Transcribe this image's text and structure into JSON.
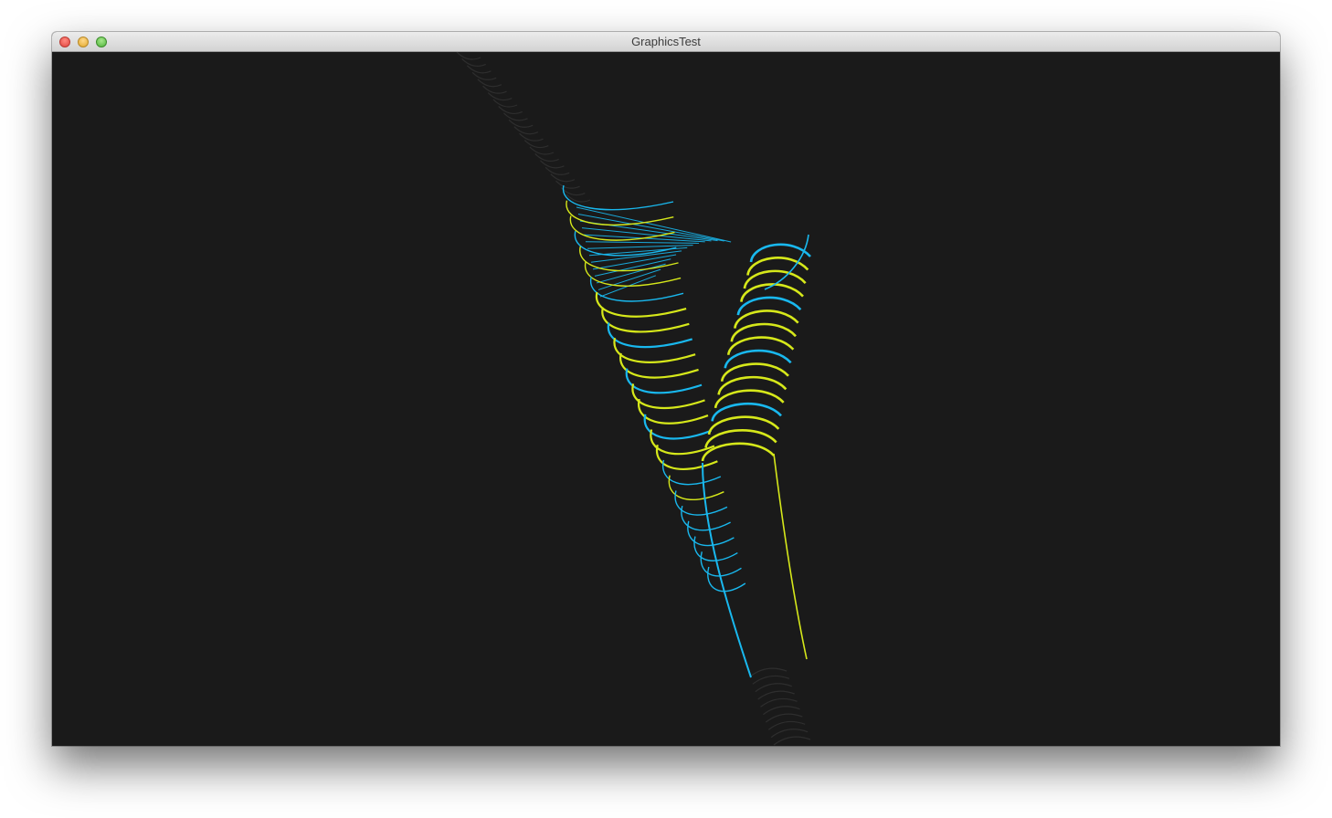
{
  "window": {
    "title": "GraphicsTest",
    "controls": {
      "close": "close-button",
      "minimize": "minimize-button",
      "maximize": "zoom-button"
    }
  },
  "render": {
    "background_color": "#1a1a1a",
    "colors": {
      "cyan": "#19b8ee",
      "yellow": "#d6e81a",
      "faint": "#2e2e2e"
    }
  }
}
